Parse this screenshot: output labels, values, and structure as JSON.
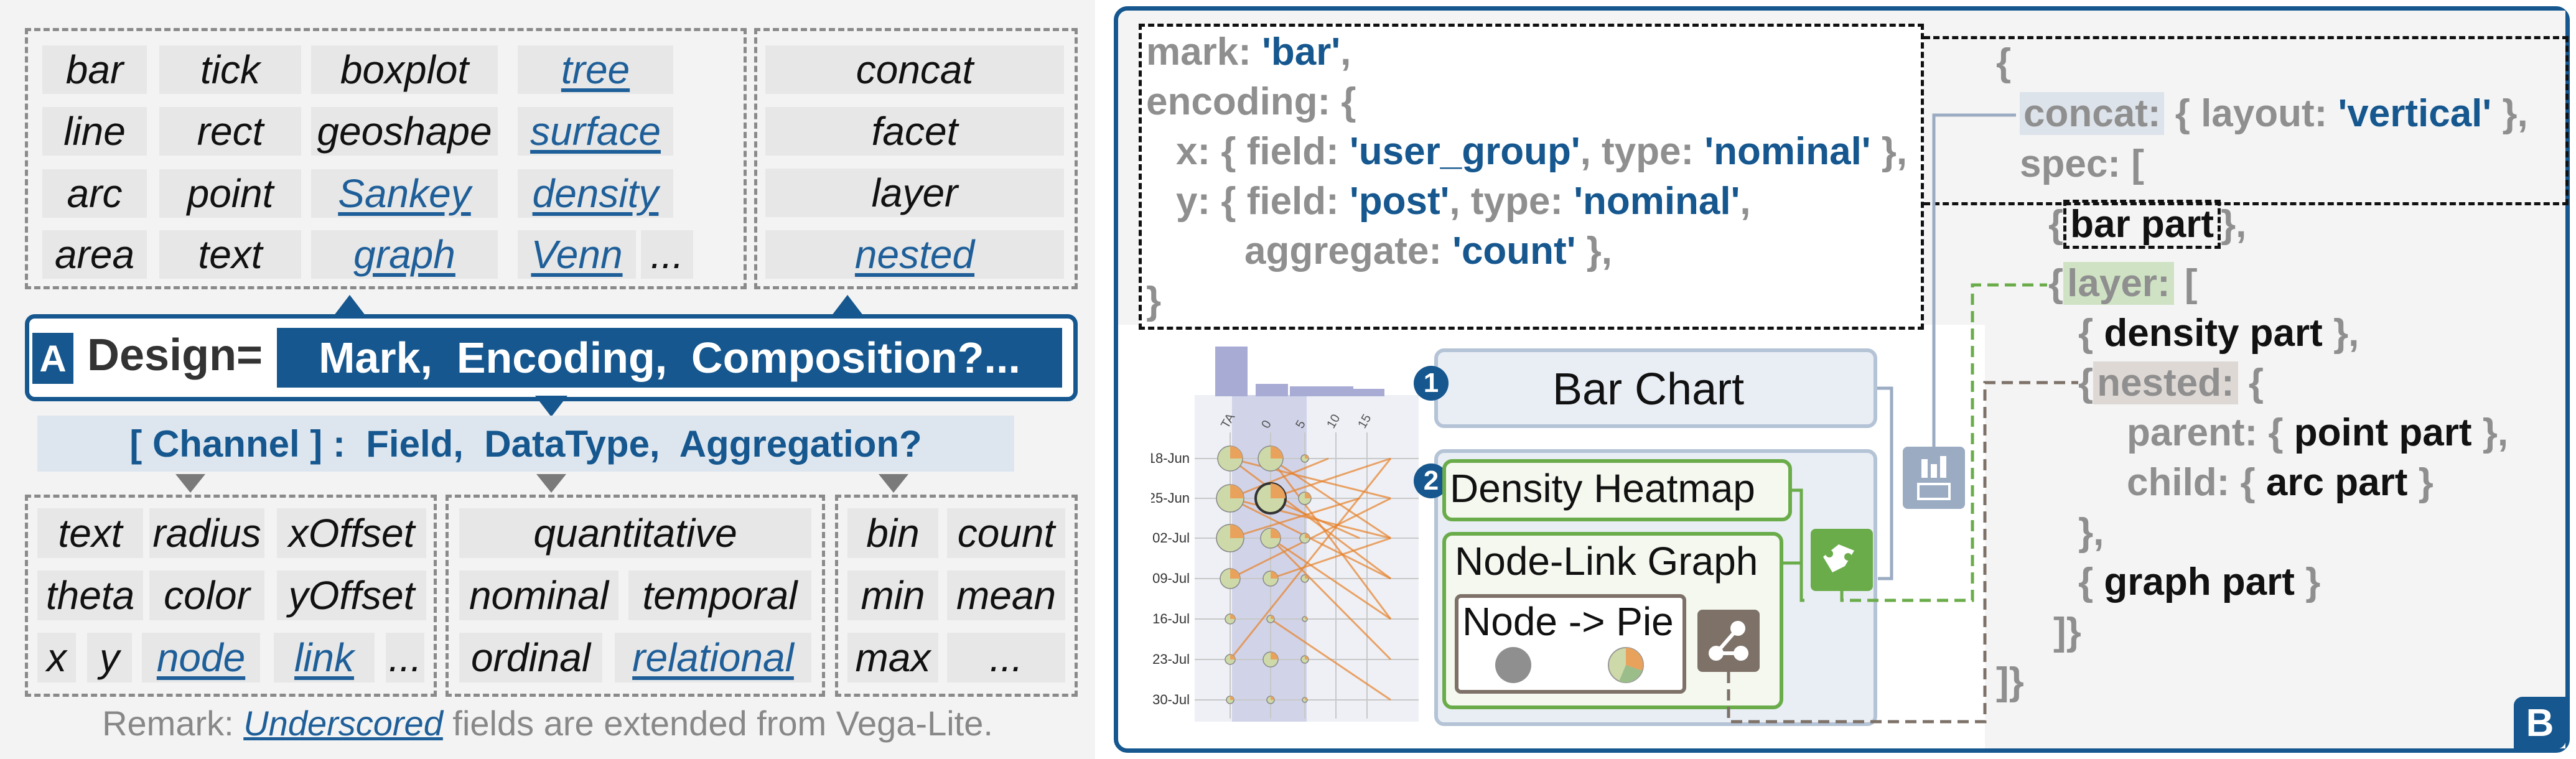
{
  "panel_a": {
    "mark_grid": [
      [
        "bar",
        "tick",
        "boxplot",
        "tree"
      ],
      [
        "line",
        "rect",
        "geoshape",
        "surface"
      ],
      [
        "arc",
        "point",
        "Sankey",
        "density"
      ],
      [
        "area",
        "text",
        "graph",
        "Venn"
      ]
    ],
    "mark_ellipsis": "...",
    "composition_list": [
      "concat",
      "facet",
      "layer",
      "nested"
    ],
    "badge": "A",
    "design_label": "Design=",
    "design_value": "Mark,  Encoding,  Composition?...",
    "channel_line": "[ Channel ] :  Field,  DataType,  Aggregation?",
    "channel_grid": [
      [
        "text",
        "radius",
        "xOffset"
      ],
      [
        "theta",
        "color",
        "yOffset"
      ],
      [
        "x",
        "y",
        "node",
        "link",
        "..."
      ]
    ],
    "datatype_grid": [
      [
        "quantitative"
      ],
      [
        "nominal",
        "temporal"
      ],
      [
        "ordinal",
        "relational"
      ]
    ],
    "aggregation_grid": [
      [
        "bin",
        "count"
      ],
      [
        "min",
        "mean"
      ],
      [
        "max",
        "..."
      ]
    ],
    "remark_prefix": "Remark: ",
    "remark_link": "Underscored",
    "remark_suffix": " fields are extended from Vega-Lite."
  },
  "panel_b": {
    "badge": "B",
    "code_left": {
      "l1_key": "mark: ",
      "l1_val": "'bar'",
      "l1_end": ",",
      "l2": "encoding: {",
      "l3_key": "x: { field: ",
      "l3_val1": "'user_group'",
      "l3_mid": ", type: ",
      "l3_val2": "'nominal'",
      "l3_end": " },",
      "l4_key": "y: { field: ",
      "l4_val1": "'post'",
      "l4_mid": ", type: ",
      "l4_val2": "'nominal'",
      "l4_end": ",",
      "l5_key": "aggregate: ",
      "l5_val": "'count'",
      "l5_end": " },",
      "l6": "}"
    },
    "code_right": {
      "r1": "{",
      "r2_key": "concat:",
      "r2_a": " { layout: ",
      "r2_val": "'vertical'",
      "r2_b": " },",
      "r3": "spec: [",
      "r4_a": "{",
      "r4_b": "bar part",
      "r4_c": "},",
      "r5_a": "{",
      "r5_key": "layer:",
      "r5_b": " [",
      "r6_a": "{ ",
      "r6_b": "density part",
      "r6_c": " },",
      "r7_a": "{",
      "r7_key": "nested:",
      "r7_b": " {",
      "r8_a": "parent: { ",
      "r8_b": "point part",
      "r8_c": " },",
      "r9_a": "child: { ",
      "r9_b": "arc part",
      "r9_c": " }",
      "r10": "},",
      "r11_a": "{ ",
      "r11_b": "graph part",
      "r11_c": " }",
      "r12": "]}",
      "r13": "]}"
    },
    "boxes": {
      "num1": "1",
      "num2": "2",
      "bar_chart": "Bar Chart",
      "density_heatmap": "Density Heatmap",
      "node_link": "Node-Link Graph",
      "node_pie": "Node -> Pie"
    },
    "thumbnail": {
      "x_ticks": [
        "TA",
        "0",
        "5",
        "10",
        "15"
      ],
      "y_ticks": [
        "18-Jun",
        "25-Jun",
        "02-Jul",
        "09-Jul",
        "16-Jul",
        "23-Jul",
        "30-Jul"
      ]
    },
    "colors": {
      "accent": "#15578e",
      "layer_green": "#6aac4a",
      "concat_gray": "#9aabc2",
      "nested_brown": "#7d7168",
      "edge_orange": "#e8822a"
    }
  }
}
